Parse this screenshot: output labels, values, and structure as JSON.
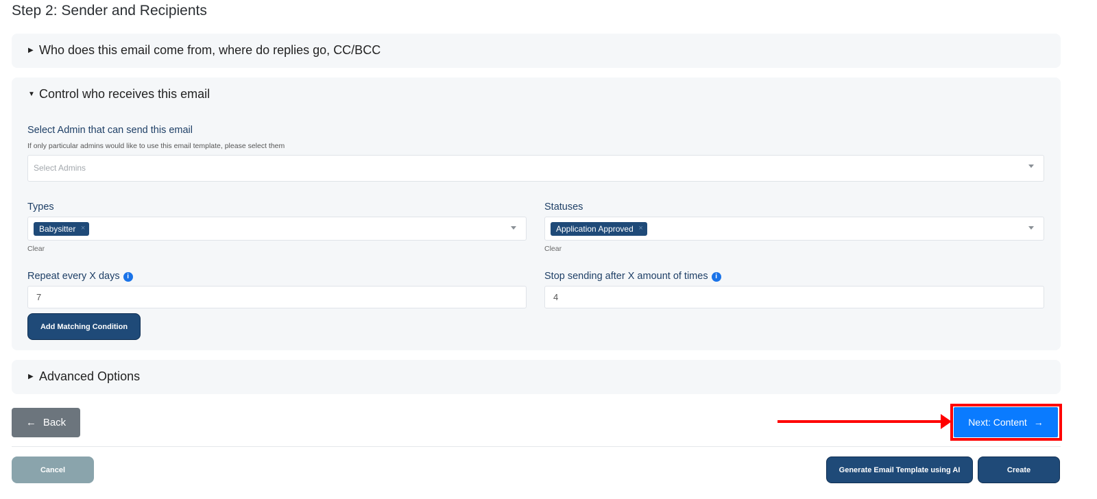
{
  "page": {
    "title": "Step 2: Sender and Recipients"
  },
  "sections": {
    "sender": {
      "label": "Who does this email come from, where do replies go, CC/BCC"
    },
    "control": {
      "label": "Control who receives this email",
      "admins": {
        "label": "Select Admin that can send this email",
        "hint": "If only particular admins would like to use this email template, please select them",
        "placeholder": "Select Admins"
      },
      "types": {
        "label": "Types",
        "selected": "Babysitter",
        "clear": "Clear"
      },
      "statuses": {
        "label": "Statuses",
        "selected": "Application Approved",
        "clear": "Clear"
      },
      "repeat": {
        "label": "Repeat every X days",
        "value": "7"
      },
      "stop": {
        "label": "Stop sending after X amount of times",
        "value": "4"
      },
      "add_condition": "Add Matching Condition"
    },
    "advanced": {
      "label": "Advanced Options"
    }
  },
  "nav": {
    "back": "Back",
    "next": "Next: Content"
  },
  "footer": {
    "cancel": "Cancel",
    "generate": "Generate Email Template using AI",
    "create": "Create"
  },
  "colors": {
    "primary_dark": "#1f4a78",
    "next_blue": "#0a7bff",
    "annotation_red": "#ff0000"
  }
}
